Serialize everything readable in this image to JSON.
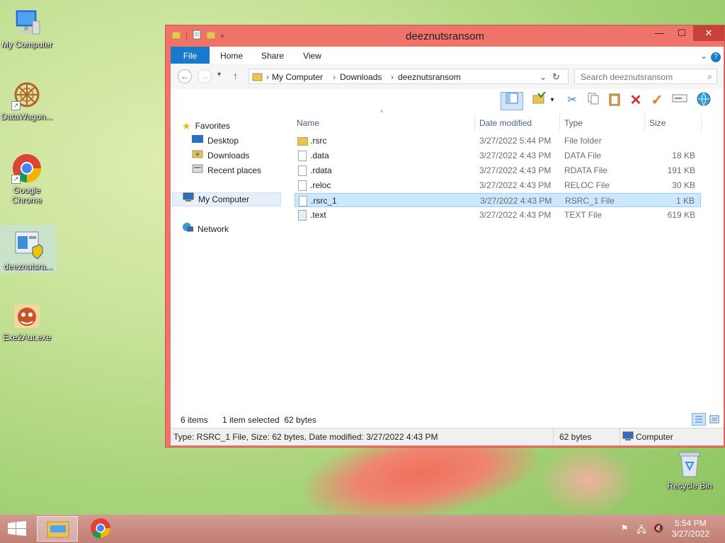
{
  "desktop": {
    "icons": [
      {
        "label": "My Computer"
      },
      {
        "label": "DataWagon..."
      },
      {
        "label": "Google Chrome"
      },
      {
        "label": "deeznutsra..."
      },
      {
        "label": "Exe2Aut.exe"
      },
      {
        "label": "Recycle Bin"
      }
    ]
  },
  "window": {
    "title": "deeznutsransom",
    "tabs": [
      "File",
      "Home",
      "Share",
      "View"
    ],
    "address": [
      "My Computer",
      "Downloads",
      "deeznutsransom"
    ],
    "search_placeholder": "Search deeznutsransom"
  },
  "navpane": {
    "favorites": "Favorites",
    "desktop": "Desktop",
    "downloads": "Downloads",
    "recent": "Recent places",
    "mycomputer": "My Computer",
    "network": "Network"
  },
  "filelist": {
    "columns": [
      "Name",
      "Date modified",
      "Type",
      "Size"
    ],
    "rows": [
      {
        "name": ".rsrc",
        "date": "3/27/2022 5:44 PM",
        "type": "File folder",
        "size": ""
      },
      {
        "name": ".data",
        "date": "3/27/2022 4:43 PM",
        "type": "DATA File",
        "size": "18 KB"
      },
      {
        "name": ".rdata",
        "date": "3/27/2022 4:43 PM",
        "type": "RDATA File",
        "size": "191 KB"
      },
      {
        "name": ".reloc",
        "date": "3/27/2022 4:43 PM",
        "type": "RELOC File",
        "size": "30 KB"
      },
      {
        "name": ".rsrc_1",
        "date": "3/27/2022 4:43 PM",
        "type": "RSRC_1 File",
        "size": "1 KB"
      },
      {
        "name": ".text",
        "date": "3/27/2022 4:43 PM",
        "type": "TEXT File",
        "size": "619 KB"
      }
    ]
  },
  "status": {
    "items": "6 items",
    "selected": "1 item selected  62 bytes",
    "details": "Type: RSRC_1 File, Size: 62 bytes, Date modified: 3/27/2022 4:43 PM",
    "size": "62 bytes",
    "location": "Computer"
  },
  "taskbar": {
    "time": "5:54 PM",
    "date": "3/27/2022"
  }
}
